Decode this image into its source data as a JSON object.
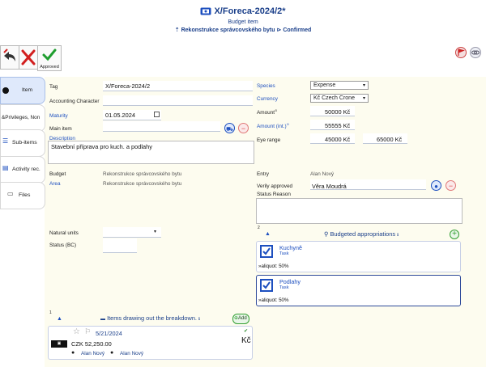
{
  "header": {
    "title": "X/Foreca-2024/2*",
    "subtitle": "Budget item",
    "project": "Rekonstrukce správcovského bytu",
    "status": "Confirmed"
  },
  "toolbar": {
    "approve_label": "Approved"
  },
  "sidebar": {
    "items": [
      {
        "label": "Item"
      },
      {
        "label": "&Privileges, Non"
      },
      {
        "label": "Sub-items"
      },
      {
        "label": "Activity rec."
      },
      {
        "label": "Files"
      }
    ]
  },
  "form": {
    "left": {
      "tag_label": "Tag",
      "tag_value": "X/Foreca-2024/2",
      "accounting_label": "Accounting Character",
      "maturity_label": "Maturity",
      "maturity_value": "01.05.2024",
      "main_item_label": "Main item",
      "description_label": "Description",
      "description_value": "Stavební přípravа pro kuch. a podlahy",
      "budget_label": "Budget",
      "budget_value": "Rekonstrukce správcovského bytu",
      "area_label": "Area",
      "area_value": "Rekonstrukce správcovského bytu",
      "natural_units_label": "Natural units",
      "status_bc_label": "Status (BC)"
    },
    "right": {
      "species_label": "Species",
      "species_value": "Expense",
      "currency_label": "Currency",
      "currency_value": "Kč Czech Crone",
      "amount_label": "Amount",
      "amount_value": "50000 Kč",
      "amount_int_label": "Amount (int.)",
      "amount_int_value": "55555 Kč",
      "eye_range_label": "Eye range",
      "eye_range_from": "45000 Kč",
      "eye_range_to": "65000 Kč",
      "entry_label": "Entry",
      "entry_value": "Alan Nový",
      "verily_label": "Verily approved",
      "verily_value": "Věra Moudrá",
      "status_reason_label": "Status Reason"
    }
  },
  "appropriations": {
    "count": "2",
    "title": "Budgeted appropriations",
    "items": [
      {
        "title": "Kuchyně",
        "type": "Task",
        "aliquot": "»aliquot: 50%"
      },
      {
        "title": "Podlahy",
        "type": "Task",
        "aliquot": "»aliquot: 50%"
      }
    ]
  },
  "drawing": {
    "count": "1",
    "title": "Items drawing out the breakdown.",
    "add_label": "Add",
    "card": {
      "date": "5/21/2024",
      "amount": "CZK 52,250.00",
      "currency": "Kč",
      "person1": "Alan Nový",
      "person2": "Alan Nový"
    }
  }
}
